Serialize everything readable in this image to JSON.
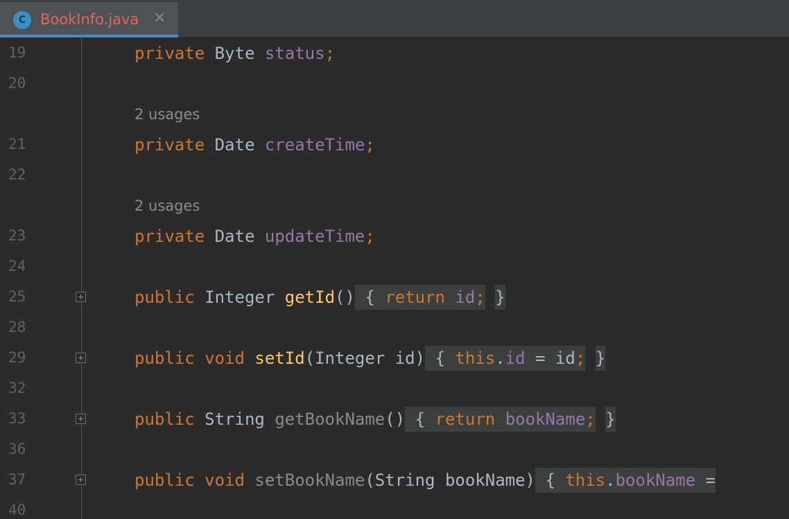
{
  "tab": {
    "icon_letter": "C",
    "title": "BookInfo.java",
    "close": "×"
  },
  "hints": {
    "usages": "2 usages"
  },
  "lines": {
    "l19": {
      "num": "19",
      "kw": "private",
      "type": "Byte",
      "field": "status",
      "semi": ";"
    },
    "l20": {
      "num": "20"
    },
    "l21": {
      "num": "21",
      "kw": "private",
      "type": "Date",
      "field": "createTime",
      "semi": ";"
    },
    "l22": {
      "num": "22"
    },
    "l23": {
      "num": "23",
      "kw": "private",
      "type": "Date",
      "field": "updateTime",
      "semi": ";"
    },
    "l24": {
      "num": "24"
    },
    "l25": {
      "num": "25",
      "kw": "public",
      "type": "Integer",
      "method": "getId",
      "params": "()",
      "open": "{",
      "ret": "return",
      "field": "id",
      "semi": ";",
      "close": "}"
    },
    "l28": {
      "num": "28"
    },
    "l29": {
      "num": "29",
      "kw": "public",
      "type": "void",
      "method": "setId",
      "params": "(Integer id)",
      "open": "{",
      "this": "this",
      "dot": ".",
      "field": "id",
      "assign": " = id",
      "semi": ";",
      "close": "}"
    },
    "l32": {
      "num": "32"
    },
    "l33": {
      "num": "33",
      "kw": "public",
      "type": "String",
      "method": "getBookName",
      "params": "()",
      "open": "{",
      "ret": "return",
      "field": "bookName",
      "semi": ";",
      "close": "}"
    },
    "l36": {
      "num": "36"
    },
    "l37": {
      "num": "37",
      "kw": "public",
      "type": "void",
      "method": "setBookName",
      "params": "(String bookName)",
      "open": "{",
      "this": "this",
      "dot": ".",
      "field": "bookName",
      "assign": " ="
    },
    "l40": {
      "num": "40"
    }
  }
}
